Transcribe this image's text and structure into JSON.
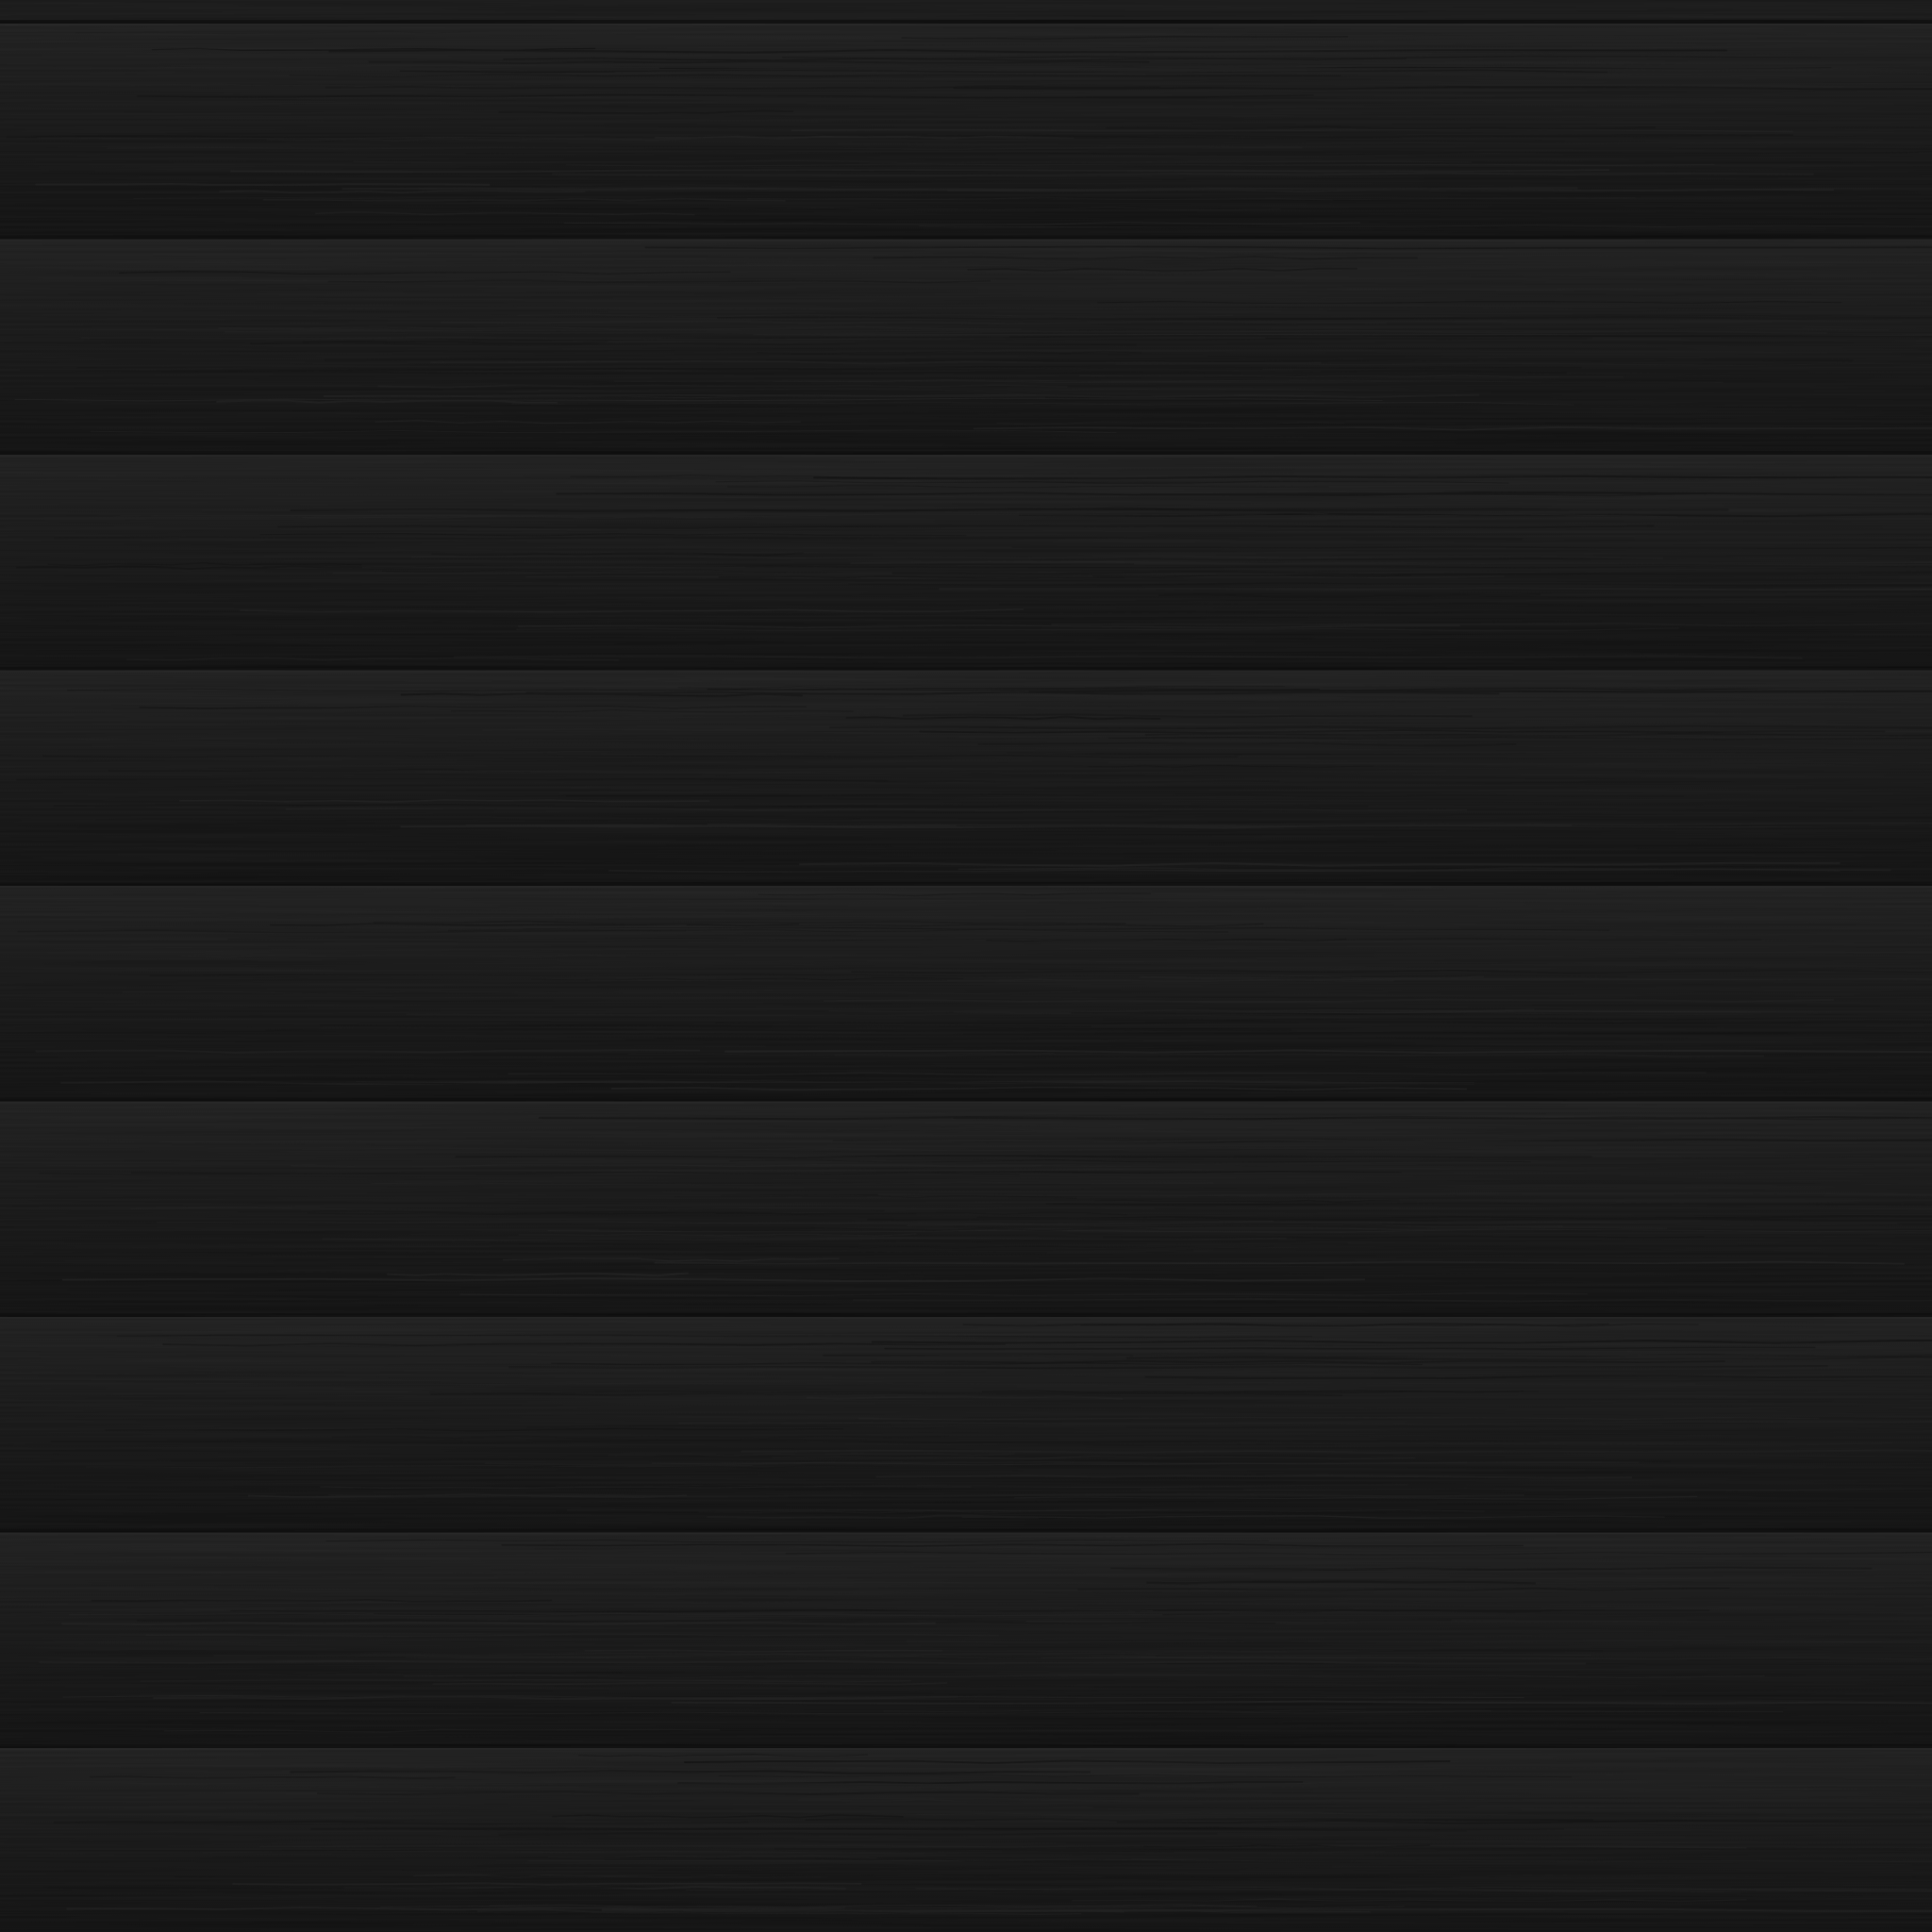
{
  "scene": {
    "subject": "dark-painted-horizontal-wood-siding",
    "board_count": 9,
    "colors": {
      "board_base": "#181818",
      "board_highlight": "#1e1e1e",
      "board_shadow": "#101010",
      "gap_line": "#0b0b0b",
      "lip_highlight": "#222222",
      "grain_dark": "#121212",
      "grain_light": "#1c1c1c"
    }
  }
}
